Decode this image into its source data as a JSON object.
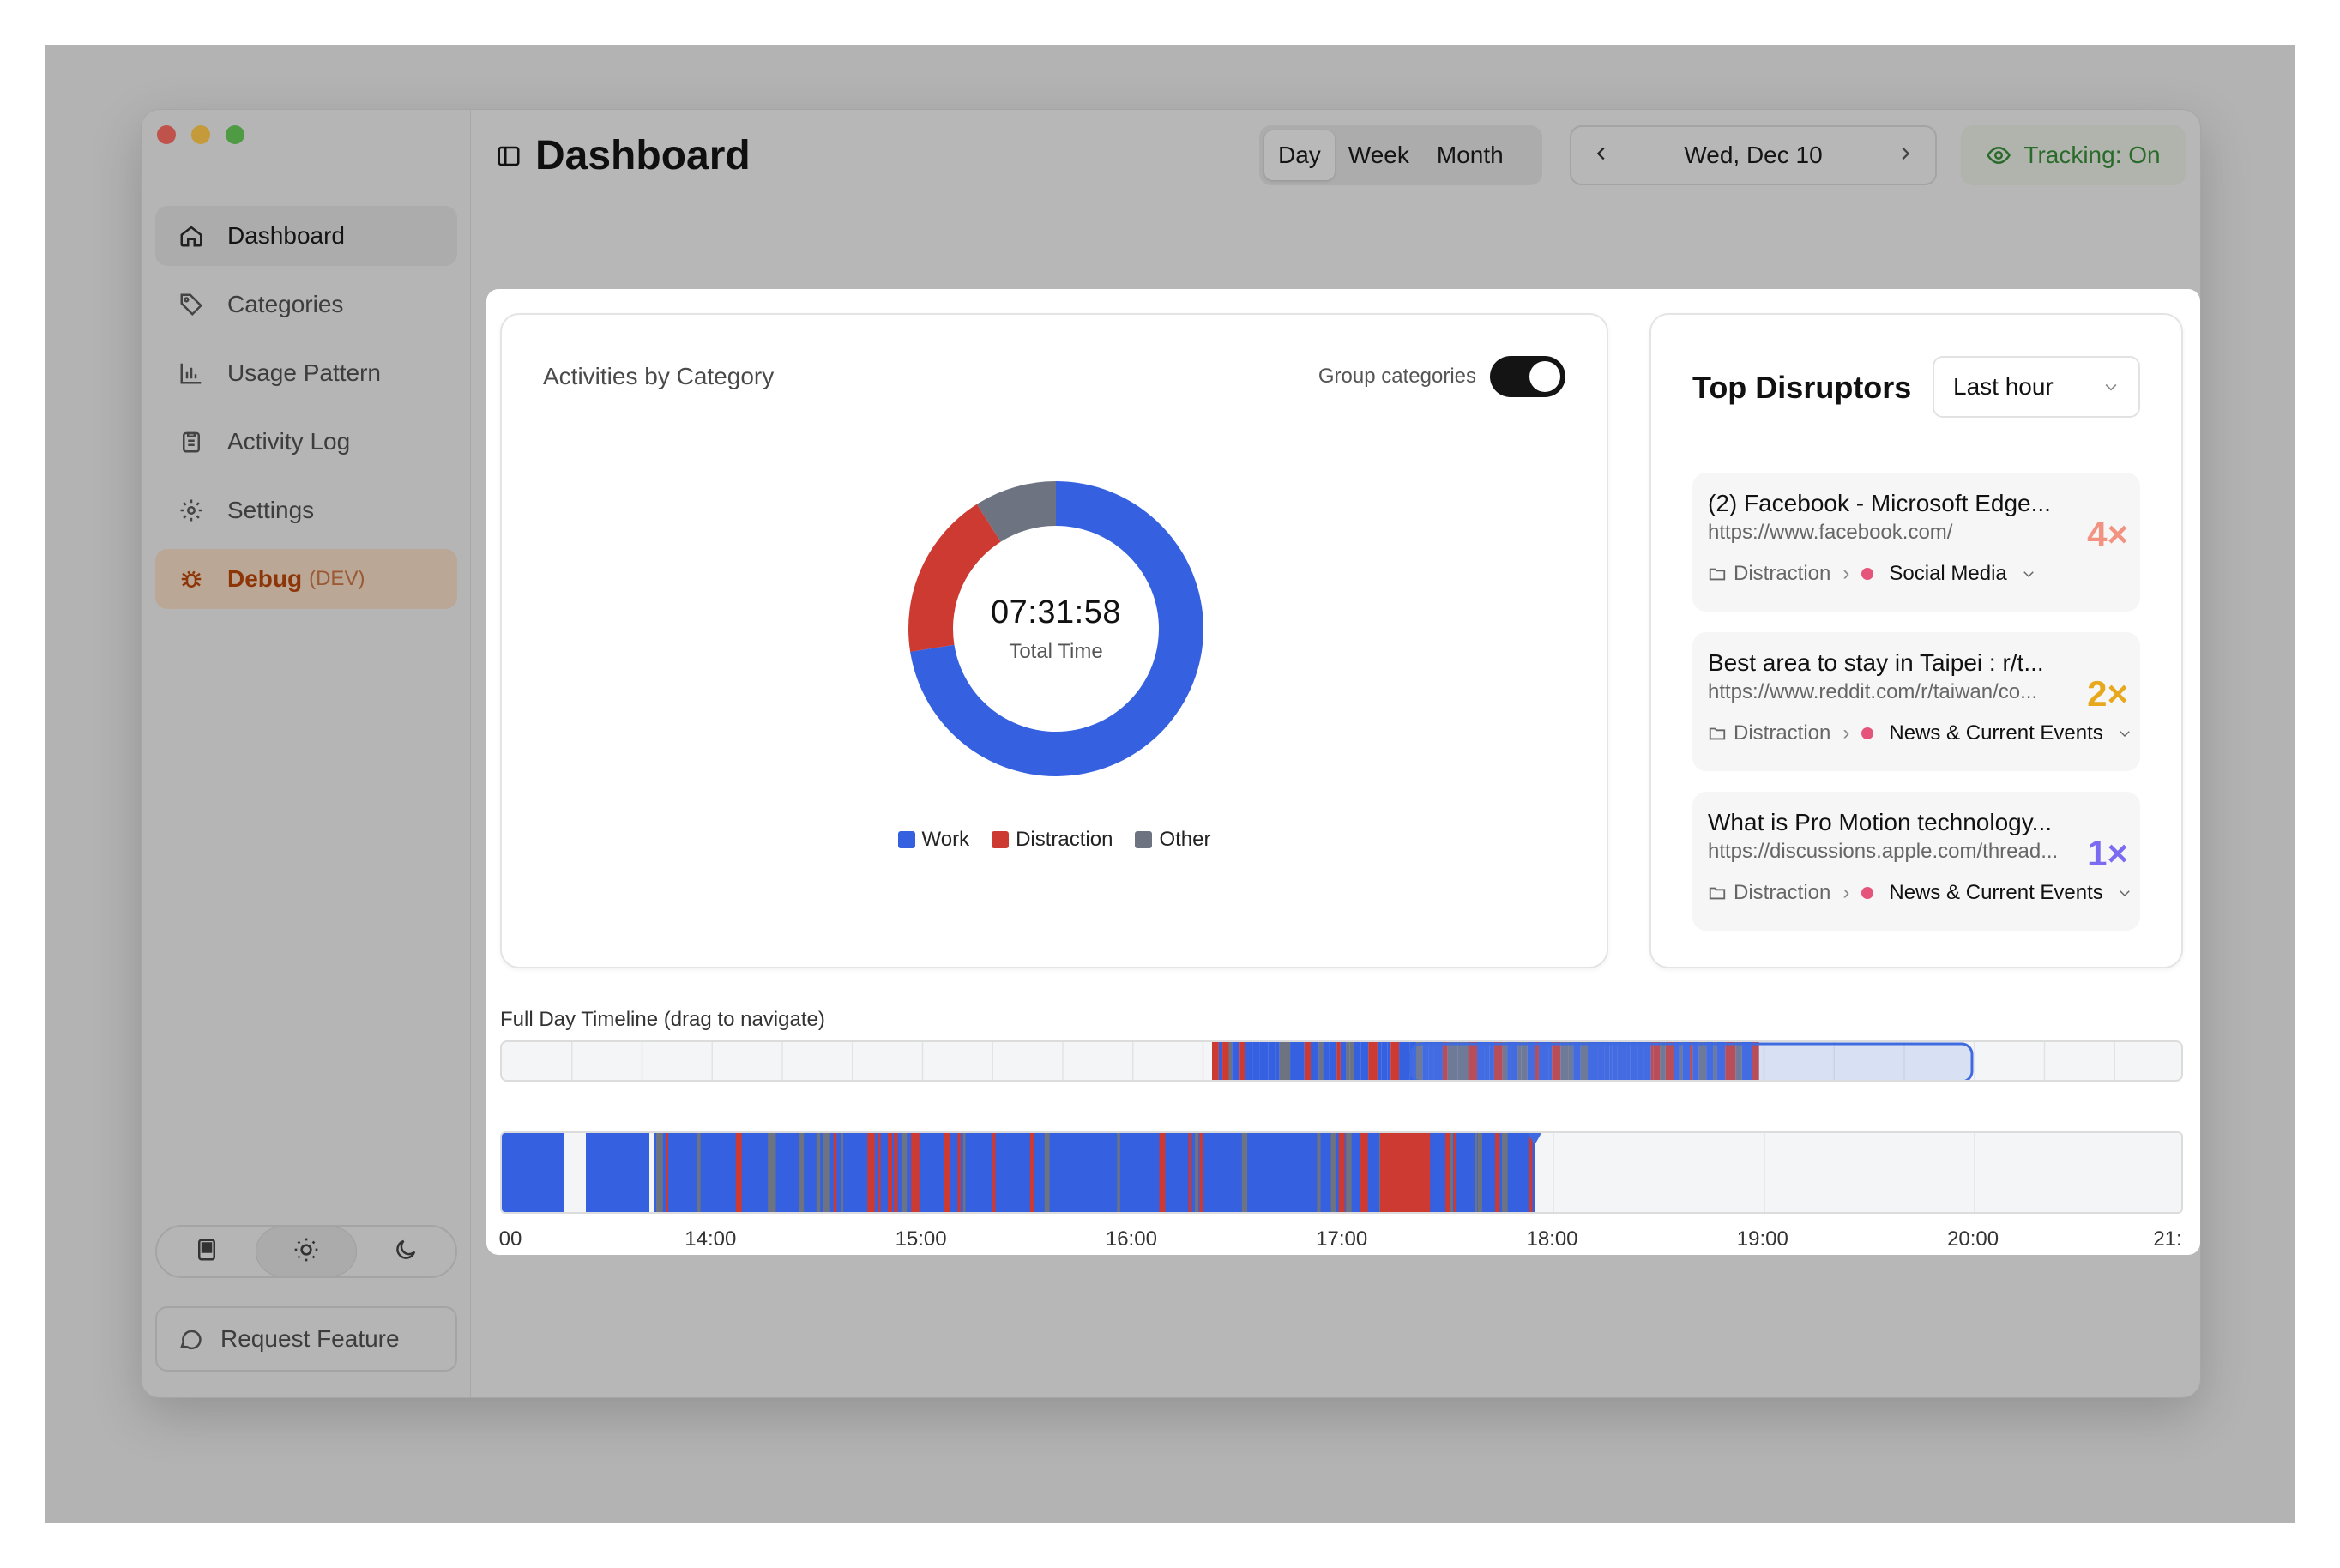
{
  "sidebar": {
    "items": [
      {
        "label": "Dashboard",
        "icon": "home-icon",
        "active": true
      },
      {
        "label": "Categories",
        "icon": "tag-icon"
      },
      {
        "label": "Usage Pattern",
        "icon": "bar-chart-icon"
      },
      {
        "label": "Activity Log",
        "icon": "clipboard-icon"
      },
      {
        "label": "Settings",
        "icon": "gear-icon"
      },
      {
        "label": "Debug",
        "badge": "(DEV)",
        "icon": "bug-icon"
      }
    ],
    "theme_options": [
      "system-theme-icon",
      "sun-icon",
      "moon-icon"
    ],
    "request_feature": "Request Feature"
  },
  "header": {
    "title": "Dashboard",
    "range_tabs": [
      "Day",
      "Week",
      "Month"
    ],
    "selected_range": "Day",
    "date": "Wed, Dec 10",
    "tracking": "Tracking: On"
  },
  "activities": {
    "title": "Activities by Category",
    "group_label": "Group categories",
    "group_on": true,
    "total_time": "07:31:58",
    "total_label": "Total Time"
  },
  "chart_data": {
    "type": "pie",
    "categories": [
      "Work",
      "Distraction",
      "Other"
    ],
    "values": [
      72.5,
      18.5,
      9
    ],
    "colors": [
      "#3560e0",
      "#cc3a32",
      "#6d7380"
    ],
    "legend_position": "bottom"
  },
  "disruptors": {
    "title": "Top Disruptors",
    "range": "Last hour",
    "items": [
      {
        "name": "(2) Facebook - Microsoft Edge...",
        "url": "https://www.facebook.com/",
        "count": "4×",
        "color": "#f29280",
        "category": "Distraction",
        "subcategory": "Social Media"
      },
      {
        "name": "Best area to stay in Taipei : r/t...",
        "url": "https://www.reddit.com/r/taiwan/co...",
        "count": "2×",
        "color": "#e8a81e",
        "category": "Distraction",
        "subcategory": "News & Current Events"
      },
      {
        "name": "What is Pro Motion technology...",
        "url": "https://discussions.apple.com/thread...",
        "count": "1×",
        "color": "#7b6af2",
        "category": "Distraction",
        "subcategory": "News & Current Events"
      }
    ]
  },
  "timeline": {
    "label": "Full Day Timeline (drag to navigate)",
    "ticks": [
      "00",
      "14:00",
      "15:00",
      "16:00",
      "17:00",
      "18:00",
      "19:00",
      "20:00",
      "21:"
    ]
  }
}
